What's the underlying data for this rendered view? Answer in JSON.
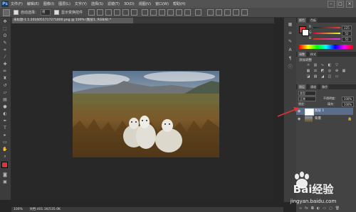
{
  "app": {
    "logo": "Ps"
  },
  "menu": [
    "文件(F)",
    "编辑(E)",
    "图像(I)",
    "图层(L)",
    "文字(Y)",
    "选择(S)",
    "滤镜(T)",
    "3D(D)",
    "视图(V)",
    "窗口(W)",
    "帮助(H)"
  ],
  "window_controls": {
    "min": "–",
    "max": "□",
    "close": "×"
  },
  "options_bar": {
    "auto_select_label": "自动选择：",
    "auto_select_value": "组",
    "transform_label": "显示变换控件"
  },
  "document_tab": {
    "title": "未标题-1 1.2016051717271800.png @ 100% (图层1, RGB/8) *"
  },
  "color_panel": {
    "tabs": [
      "颜色",
      "色板"
    ],
    "r_label": "R",
    "r_value": "225",
    "g_label": "G",
    "g_value": "52",
    "b_label": "B",
    "b_value": "52",
    "foreground": "#e13434",
    "background": "#ffffff"
  },
  "adjust_panel": {
    "tabs": [
      "调整",
      "样式"
    ],
    "title": "添加调整"
  },
  "layers_panel": {
    "tabs": [
      "图层",
      "通道",
      "路径"
    ],
    "kind_label": "类型",
    "blend_mode": "正常",
    "opacity_label": "不透明度：",
    "opacity_value": "100%",
    "lock_label": "锁定：",
    "fill_label": "填充：",
    "fill_value": "100%",
    "layers": [
      {
        "name": "图层 1",
        "selected": true
      },
      {
        "name": "背景",
        "selected": false
      }
    ]
  },
  "status_bar": {
    "zoom": "100%",
    "doc_info": "文档:401.1K/535.0K"
  },
  "watermark": {
    "brand": "Bai经验",
    "url": "jingyan.baidu.com"
  },
  "colors": {
    "accent_red": "#e13434",
    "selected_layer": "#5a6e8c"
  }
}
